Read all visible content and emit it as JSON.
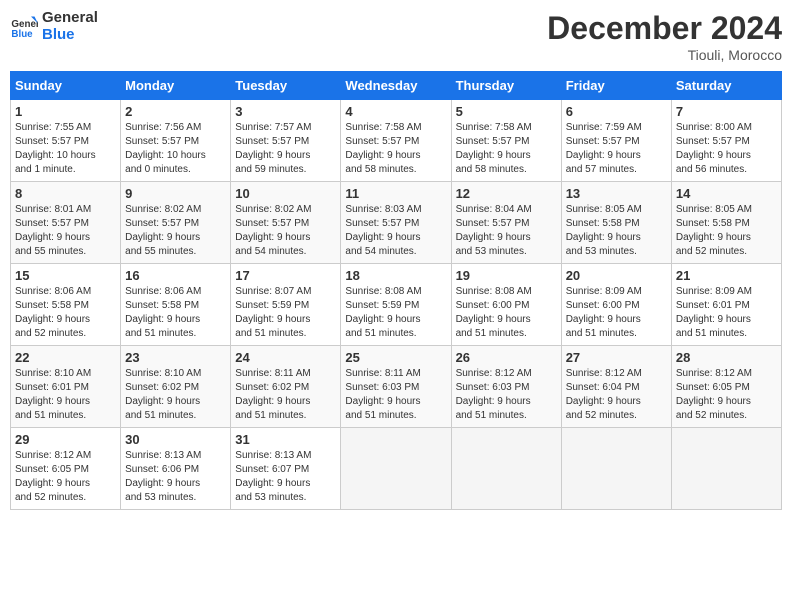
{
  "header": {
    "logo_line1": "General",
    "logo_line2": "Blue",
    "month_title": "December 2024",
    "location": "Tiouli, Morocco"
  },
  "weekdays": [
    "Sunday",
    "Monday",
    "Tuesday",
    "Wednesday",
    "Thursday",
    "Friday",
    "Saturday"
  ],
  "weeks": [
    [
      {
        "day": "1",
        "info": "Sunrise: 7:55 AM\nSunset: 5:57 PM\nDaylight: 10 hours\nand 1 minute."
      },
      {
        "day": "2",
        "info": "Sunrise: 7:56 AM\nSunset: 5:57 PM\nDaylight: 10 hours\nand 0 minutes."
      },
      {
        "day": "3",
        "info": "Sunrise: 7:57 AM\nSunset: 5:57 PM\nDaylight: 9 hours\nand 59 minutes."
      },
      {
        "day": "4",
        "info": "Sunrise: 7:58 AM\nSunset: 5:57 PM\nDaylight: 9 hours\nand 58 minutes."
      },
      {
        "day": "5",
        "info": "Sunrise: 7:58 AM\nSunset: 5:57 PM\nDaylight: 9 hours\nand 58 minutes."
      },
      {
        "day": "6",
        "info": "Sunrise: 7:59 AM\nSunset: 5:57 PM\nDaylight: 9 hours\nand 57 minutes."
      },
      {
        "day": "7",
        "info": "Sunrise: 8:00 AM\nSunset: 5:57 PM\nDaylight: 9 hours\nand 56 minutes."
      }
    ],
    [
      {
        "day": "8",
        "info": "Sunrise: 8:01 AM\nSunset: 5:57 PM\nDaylight: 9 hours\nand 55 minutes."
      },
      {
        "day": "9",
        "info": "Sunrise: 8:02 AM\nSunset: 5:57 PM\nDaylight: 9 hours\nand 55 minutes."
      },
      {
        "day": "10",
        "info": "Sunrise: 8:02 AM\nSunset: 5:57 PM\nDaylight: 9 hours\nand 54 minutes."
      },
      {
        "day": "11",
        "info": "Sunrise: 8:03 AM\nSunset: 5:57 PM\nDaylight: 9 hours\nand 54 minutes."
      },
      {
        "day": "12",
        "info": "Sunrise: 8:04 AM\nSunset: 5:57 PM\nDaylight: 9 hours\nand 53 minutes."
      },
      {
        "day": "13",
        "info": "Sunrise: 8:05 AM\nSunset: 5:58 PM\nDaylight: 9 hours\nand 53 minutes."
      },
      {
        "day": "14",
        "info": "Sunrise: 8:05 AM\nSunset: 5:58 PM\nDaylight: 9 hours\nand 52 minutes."
      }
    ],
    [
      {
        "day": "15",
        "info": "Sunrise: 8:06 AM\nSunset: 5:58 PM\nDaylight: 9 hours\nand 52 minutes."
      },
      {
        "day": "16",
        "info": "Sunrise: 8:06 AM\nSunset: 5:58 PM\nDaylight: 9 hours\nand 51 minutes."
      },
      {
        "day": "17",
        "info": "Sunrise: 8:07 AM\nSunset: 5:59 PM\nDaylight: 9 hours\nand 51 minutes."
      },
      {
        "day": "18",
        "info": "Sunrise: 8:08 AM\nSunset: 5:59 PM\nDaylight: 9 hours\nand 51 minutes."
      },
      {
        "day": "19",
        "info": "Sunrise: 8:08 AM\nSunset: 6:00 PM\nDaylight: 9 hours\nand 51 minutes."
      },
      {
        "day": "20",
        "info": "Sunrise: 8:09 AM\nSunset: 6:00 PM\nDaylight: 9 hours\nand 51 minutes."
      },
      {
        "day": "21",
        "info": "Sunrise: 8:09 AM\nSunset: 6:01 PM\nDaylight: 9 hours\nand 51 minutes."
      }
    ],
    [
      {
        "day": "22",
        "info": "Sunrise: 8:10 AM\nSunset: 6:01 PM\nDaylight: 9 hours\nand 51 minutes."
      },
      {
        "day": "23",
        "info": "Sunrise: 8:10 AM\nSunset: 6:02 PM\nDaylight: 9 hours\nand 51 minutes."
      },
      {
        "day": "24",
        "info": "Sunrise: 8:11 AM\nSunset: 6:02 PM\nDaylight: 9 hours\nand 51 minutes."
      },
      {
        "day": "25",
        "info": "Sunrise: 8:11 AM\nSunset: 6:03 PM\nDaylight: 9 hours\nand 51 minutes."
      },
      {
        "day": "26",
        "info": "Sunrise: 8:12 AM\nSunset: 6:03 PM\nDaylight: 9 hours\nand 51 minutes."
      },
      {
        "day": "27",
        "info": "Sunrise: 8:12 AM\nSunset: 6:04 PM\nDaylight: 9 hours\nand 52 minutes."
      },
      {
        "day": "28",
        "info": "Sunrise: 8:12 AM\nSunset: 6:05 PM\nDaylight: 9 hours\nand 52 minutes."
      }
    ],
    [
      {
        "day": "29",
        "info": "Sunrise: 8:12 AM\nSunset: 6:05 PM\nDaylight: 9 hours\nand 52 minutes."
      },
      {
        "day": "30",
        "info": "Sunrise: 8:13 AM\nSunset: 6:06 PM\nDaylight: 9 hours\nand 53 minutes."
      },
      {
        "day": "31",
        "info": "Sunrise: 8:13 AM\nSunset: 6:07 PM\nDaylight: 9 hours\nand 53 minutes."
      },
      {
        "day": "",
        "info": ""
      },
      {
        "day": "",
        "info": ""
      },
      {
        "day": "",
        "info": ""
      },
      {
        "day": "",
        "info": ""
      }
    ]
  ]
}
